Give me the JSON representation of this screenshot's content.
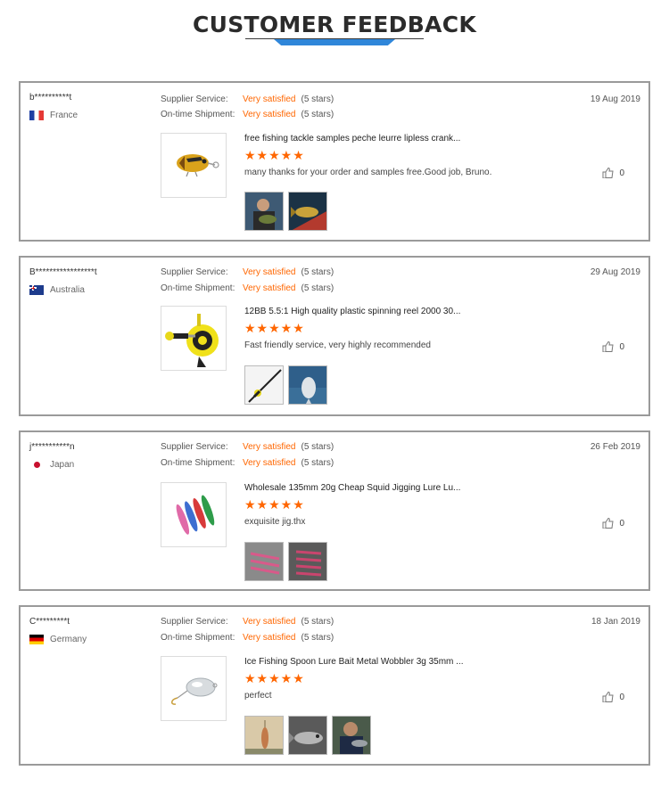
{
  "page": {
    "title": "CUSTOMER FEEDBACK"
  },
  "labels": {
    "supplier_service": "Supplier Service:",
    "ontime_shipment": "On-time Shipment:"
  },
  "colors": {
    "accent": "#ff6600",
    "header_blue": "#2f86d9",
    "border": "#9a9a9a"
  },
  "reviews": [
    {
      "user": "b**********t",
      "country": "France",
      "flag": "flag-france",
      "date": "19 Aug 2019",
      "supplier_value": "Very satisfied",
      "supplier_stars": "(5 stars)",
      "shipment_value": "Very satisfied",
      "shipment_stars": "(5 stars)",
      "product": "free fishing tackle samples peche leurre lipless crank...",
      "rating": "★★★★★",
      "comment": "many thanks for your order and samples free.Good job, Bruno.",
      "likes": "0"
    },
    {
      "user": "B*****************t",
      "country": "Australia",
      "flag": "flag-australia",
      "date": "29 Aug 2019",
      "supplier_value": "Very satisfied",
      "supplier_stars": "(5 stars)",
      "shipment_value": "Very satisfied",
      "shipment_stars": "(5 stars)",
      "product": "12BB 5.5:1 High quality plastic spinning reel 2000 30...",
      "rating": "★★★★★",
      "comment": "Fast friendly service, very highly recommended",
      "likes": "0"
    },
    {
      "user": "j***********n",
      "country": "Japan",
      "flag": "flag-japan",
      "date": "26 Feb 2019",
      "supplier_value": "Very satisfied",
      "supplier_stars": "(5 stars)",
      "shipment_value": "Very satisfied",
      "shipment_stars": "(5 stars)",
      "product": "Wholesale 135mm 20g Cheap Squid Jigging Lure Lu...",
      "rating": "★★★★★",
      "comment": "exquisite jig.thx",
      "likes": "0"
    },
    {
      "user": "C*********t",
      "country": "Germany",
      "flag": "flag-germany",
      "date": "18 Jan 2019",
      "supplier_value": "Very satisfied",
      "supplier_stars": "(5 stars)",
      "shipment_value": "Very satisfied",
      "shipment_stars": "(5 stars)",
      "product": "Ice Fishing Spoon Lure Bait Metal Wobbler 3g 35mm ...",
      "rating": "★★★★★",
      "comment": "perfect",
      "likes": "0"
    }
  ]
}
